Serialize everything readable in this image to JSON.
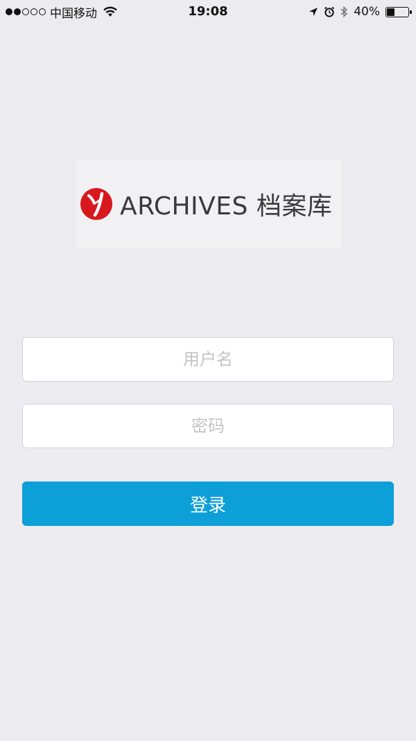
{
  "status_bar": {
    "carrier": "中国移动",
    "time": "19:08",
    "battery_percent_label": "40%",
    "battery_level": 0.4,
    "signal_bars_filled": 2,
    "signal_bars_total": 5,
    "icons": [
      "wifi-icon",
      "location-arrow-icon",
      "alarm-icon",
      "bluetooth-icon",
      "battery-icon"
    ]
  },
  "logo": {
    "text": "ARCHIVES 档案库",
    "mark_color": "#d7191f"
  },
  "form": {
    "username_placeholder": "用户名",
    "password_placeholder": "密码",
    "login_label": "登录"
  },
  "colors": {
    "background": "#ebebf0",
    "primary": "#0c9fd8"
  }
}
